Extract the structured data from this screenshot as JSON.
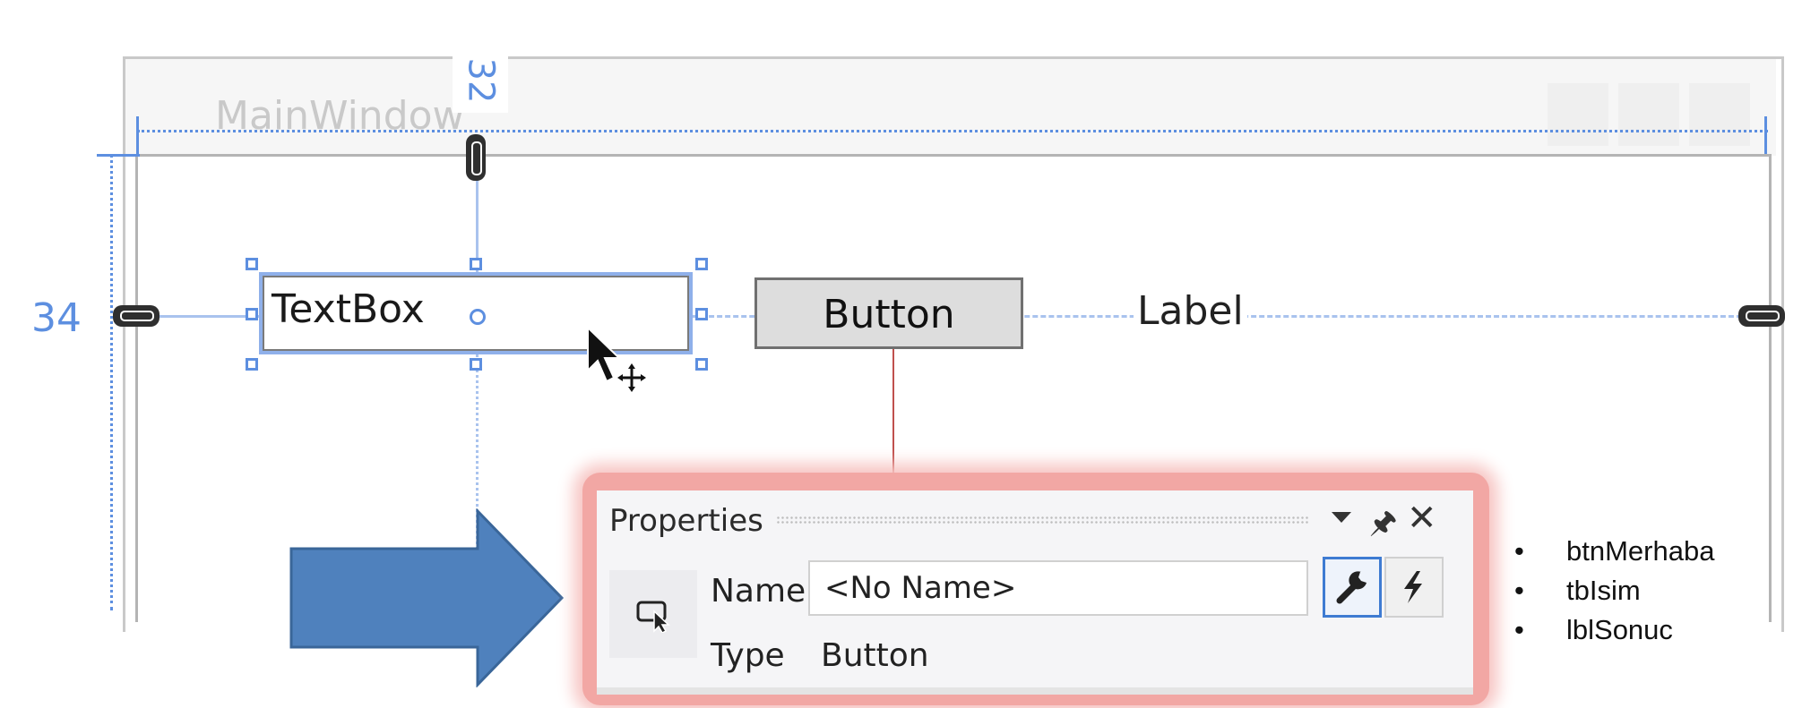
{
  "designer": {
    "window_title": "MainWindow",
    "margin_left": "34",
    "margin_top": "32",
    "textbox_text": "TextBox",
    "button_text": "Button",
    "label_text": "Label"
  },
  "properties": {
    "title": "Properties",
    "name_label": "Name",
    "name_value": "<No Name>",
    "type_label": "Type",
    "type_value": "Button"
  },
  "notes": {
    "items": [
      "btnMerhaba",
      "tbIsim",
      "lblSonuc"
    ]
  },
  "colors": {
    "guide_blue": "#5d8fe0",
    "arrow_blue": "#4f81bd",
    "highlight_red": "#f2a7a4",
    "pointer_red": "#c0504d"
  }
}
